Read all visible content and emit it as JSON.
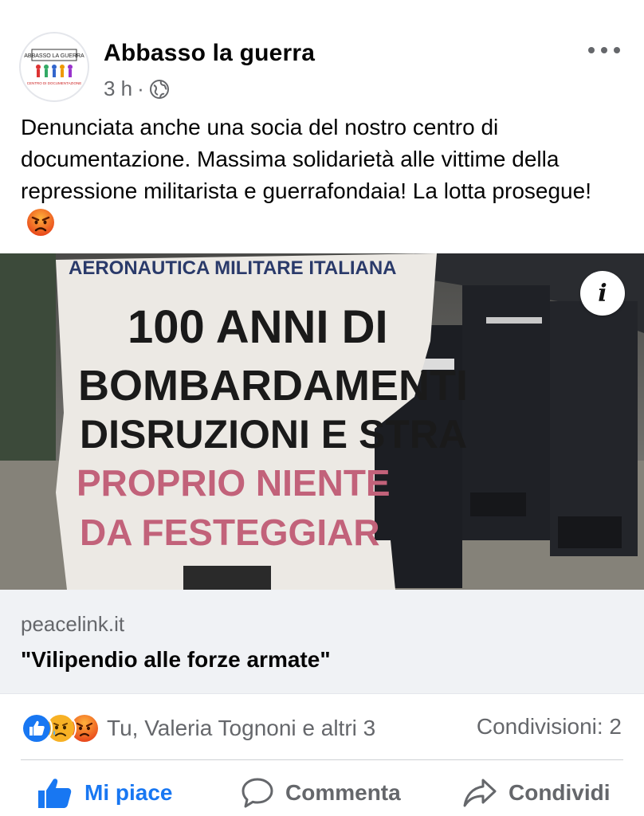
{
  "post": {
    "page_name": "Abbasso la guerra",
    "time": "3 h",
    "separator": "·",
    "privacy_icon": "globe-icon",
    "more_icon": "more-horizontal-icon",
    "avatar_banner_text": "ABBASSO LA GUERRA",
    "avatar_caption": "CENTRO DI DOCUMENTAZIONE",
    "text": "Denunciata anche una socia del nostro centro di documentazione. Massima solidarietà alle vittime della repressione militarista e guerrafondaia! La lotta prosegue!",
    "text_emoji": "angry-face-emoji"
  },
  "link": {
    "image_banner_lines": [
      "AERONAUTICA MILITARE ITALIANA",
      "100 ANNI DI",
      "BOMBARDAMENTI",
      "DISRUZIONI E STRA",
      "PROPRIO NIENTE",
      "DA FESTEGGIAR"
    ],
    "info_label": "i",
    "domain": "peacelink.it",
    "title": "\"Vilipendio alle forze armate\""
  },
  "engagement": {
    "reaction_icons": [
      "like-reaction",
      "sad-reaction",
      "angry-reaction"
    ],
    "reactions_text": "Tu, Valeria Tognoni e altri 3",
    "shares_text": "Condivisioni: 2"
  },
  "actions": {
    "like_label": "Mi piace",
    "comment_label": "Commenta",
    "share_label": "Condividi"
  },
  "colors": {
    "accent": "#1877f2",
    "secondary_text": "#65676b",
    "link_bg": "#f0f2f5"
  }
}
